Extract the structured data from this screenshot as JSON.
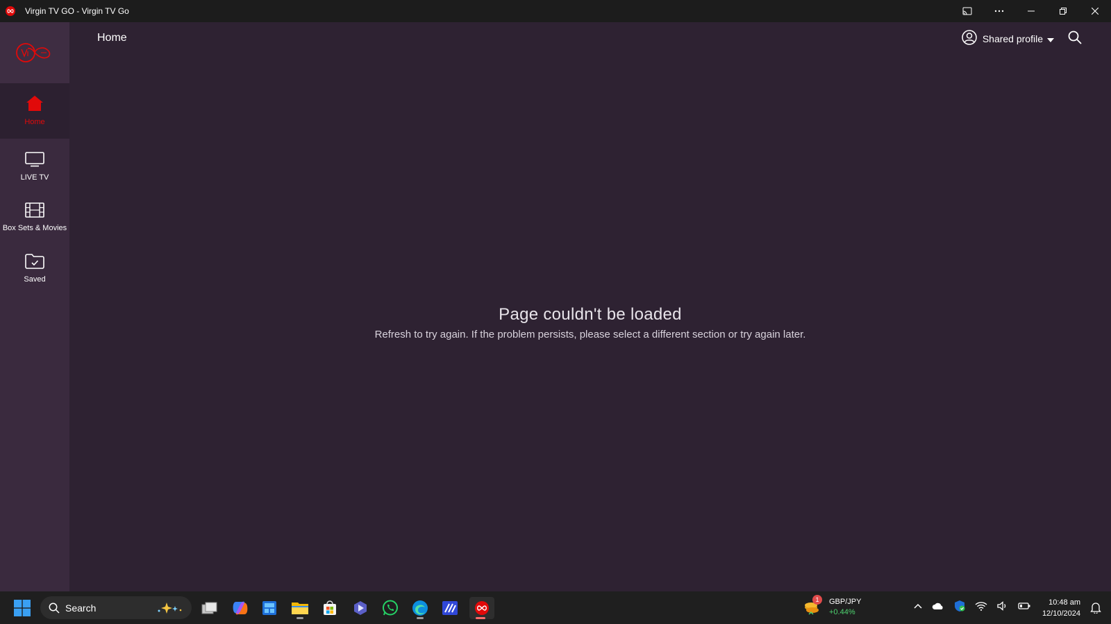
{
  "window": {
    "title": "Virgin TV GO - Virgin TV Go"
  },
  "sidebar": {
    "items": [
      {
        "label": "Home",
        "icon": "home-icon",
        "active": true
      },
      {
        "label": "LIVE TV",
        "icon": "tv-icon",
        "active": false
      },
      {
        "label": "Box Sets & Movies",
        "icon": "film-icon",
        "active": false
      },
      {
        "label": "Saved",
        "icon": "saved-folder-icon",
        "active": false
      }
    ]
  },
  "header": {
    "title": "Home",
    "profile_label": "Shared profile"
  },
  "error": {
    "heading": "Page couldn't be loaded",
    "message": "Refresh to try again. If the problem persists, please select a different section or try again later."
  },
  "taskbar": {
    "search_label": "Search",
    "ticker": {
      "badge": "1",
      "symbol": "GBP/JPY",
      "change": "+0.44%"
    },
    "clock": {
      "time": "10:48 am",
      "date": "12/10/2024"
    }
  },
  "colors": {
    "accent": "#e10a0a",
    "background": "#2e2232",
    "sidebar": "#3a2a3e",
    "ticker_up": "#4ed36f"
  }
}
